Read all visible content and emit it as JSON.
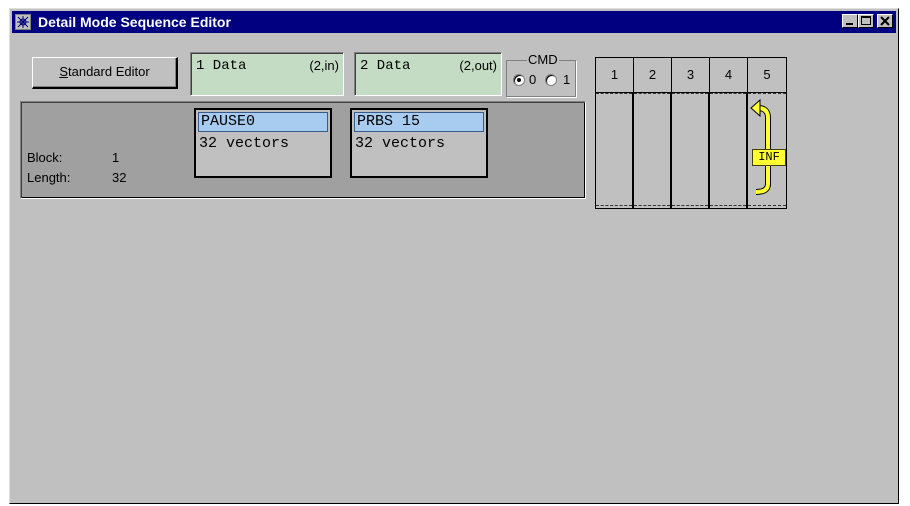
{
  "window": {
    "title": "Detail Mode Sequence Editor",
    "caption_buttons": [
      "minimize-icon",
      "maximize-icon",
      "close-icon"
    ],
    "colors": {
      "titlebar": "#000080",
      "face": "#c0c0c0"
    }
  },
  "toolbar": {
    "standard_editor_mnemonic": "S",
    "standard_editor_rest": "tandard Editor"
  },
  "data_columns": [
    {
      "label": "1 Data",
      "tag": "(2,in)",
      "color": "#c4dcc4"
    },
    {
      "label": "2 Data",
      "tag": "(2,out)",
      "color": "#c4dcc4"
    }
  ],
  "cmd": {
    "legend": "CMD",
    "options": [
      {
        "label": "0",
        "checked": true
      },
      {
        "label": "1",
        "checked": false
      }
    ]
  },
  "block_info": {
    "block_label": "Block:",
    "block_value": "1",
    "length_label": "Length:",
    "length_value": "32"
  },
  "segments": [
    {
      "name": "PAUSE0",
      "vectors": "32 vectors",
      "highlight": "#a8ccf0"
    },
    {
      "name": "PRBS 15",
      "vectors": "32 vectors",
      "highlight": "#a8ccf0"
    }
  ],
  "sequence_columns": [
    "1",
    "2",
    "3",
    "4",
    "5"
  ],
  "loop": {
    "label": "INF",
    "column": "5",
    "color": "#ffff33",
    "icon": "loop-arrow-icon"
  }
}
